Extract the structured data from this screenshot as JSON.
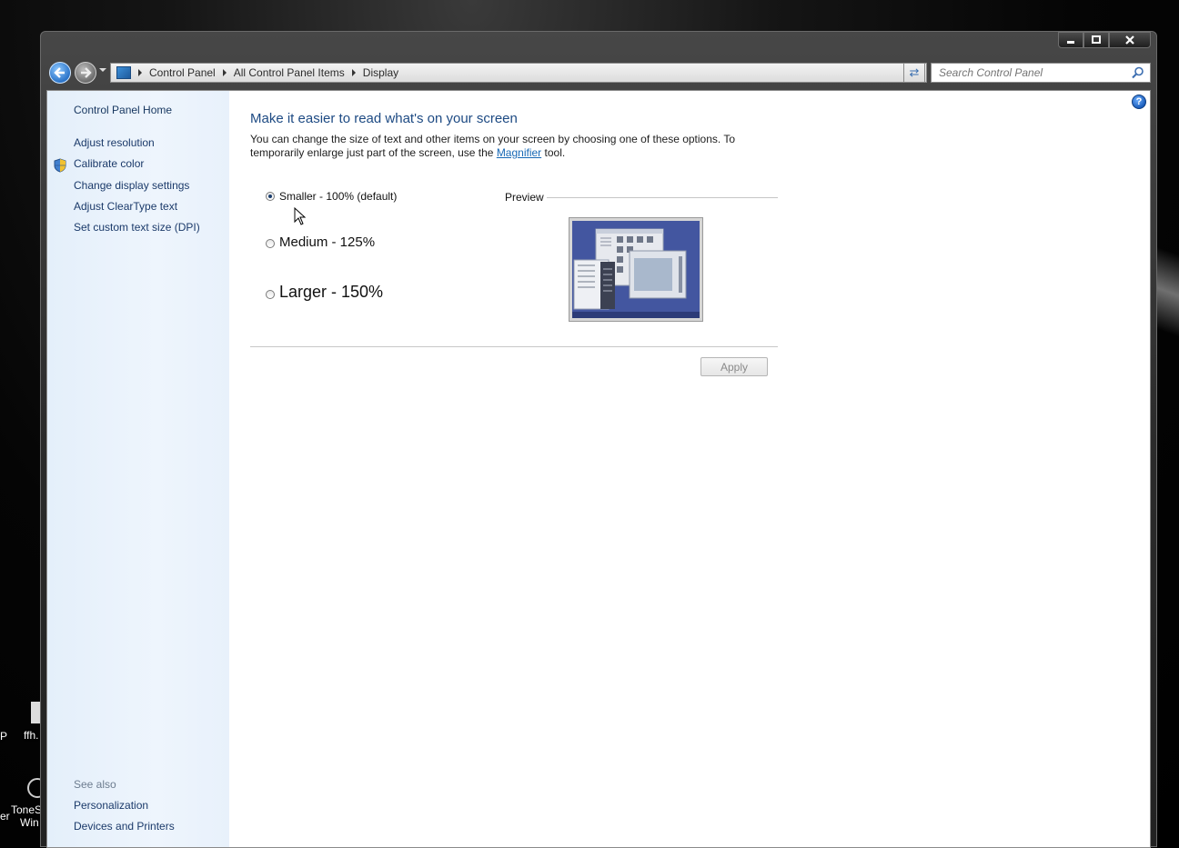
{
  "window": {
    "caption_buttons": [
      "minimize-icon",
      "maximize-icon",
      "close-icon"
    ]
  },
  "navigation": {
    "breadcrumbs": [
      "Control Panel",
      "All Control Panel Items",
      "Display"
    ],
    "search_placeholder": "Search Control Panel"
  },
  "sidebar": {
    "home": "Control Panel Home",
    "tasks": [
      "Adjust resolution",
      "Calibrate color",
      "Change display settings",
      "Adjust ClearType text",
      "Set custom text size (DPI)"
    ],
    "see_also_label": "See also",
    "see_also": [
      "Personalization",
      "Devices and Printers"
    ]
  },
  "main": {
    "title": "Make it easier to read what's on your screen",
    "description_part1": "You can change the size of text and other items on your screen by choosing one of these options. To temporarily enlarge just part of the screen, use the ",
    "magnifier_link": "Magnifier",
    "description_part2": " tool.",
    "options": [
      {
        "label": "Smaller - 100% (default)",
        "selected": true
      },
      {
        "label": "Medium - 125%",
        "selected": false
      },
      {
        "label": "Larger - 150%",
        "selected": false
      }
    ],
    "preview_label": "Preview",
    "apply_label": "Apply"
  },
  "desktop": {
    "icon_labels": [
      "ffh.",
      "ToneS",
      "Win",
      "er",
      "P"
    ]
  },
  "colors": {
    "heading": "#1d4a83",
    "link": "#1668b5",
    "sidebar": "#e8f1fb"
  }
}
